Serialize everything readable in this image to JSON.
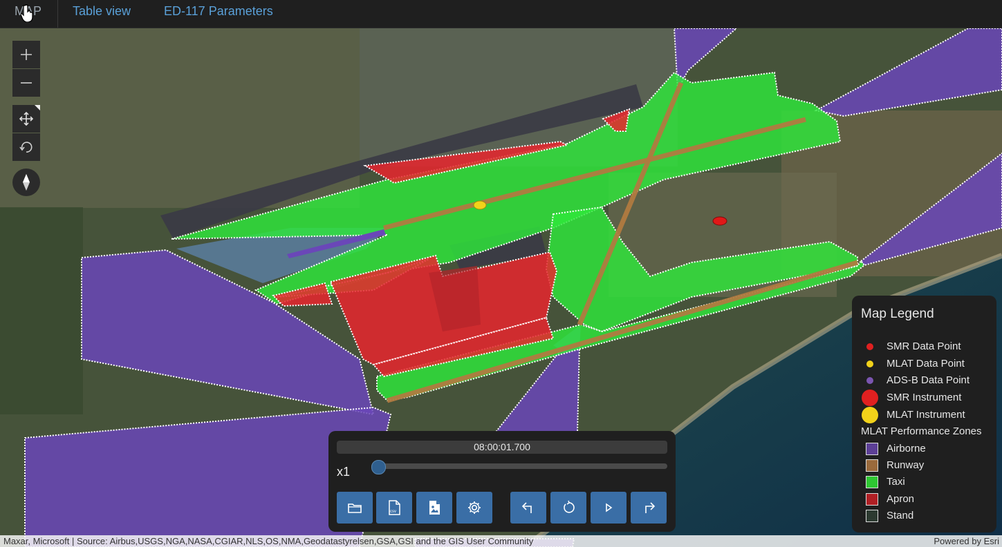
{
  "tabs": [
    {
      "label": "MAP"
    },
    {
      "label": "Table view"
    },
    {
      "label": "ED-117 Parameters"
    }
  ],
  "map_controls": {
    "zoom_in": "+",
    "zoom_out": "—",
    "icons": [
      "plus-icon",
      "minus-icon",
      "pan-icon",
      "rotate-icon",
      "compass-icon"
    ]
  },
  "attribution": {
    "left": "Maxar, Microsoft | Source: Airbus,USGS,NGA,NASA,CGIAR,NLS,OS,NMA,Geodatastyrelsen,GSA,GSI and the GIS User Community",
    "right": "Powered by Esri"
  },
  "legend": {
    "title": "Map Legend",
    "items": [
      {
        "label": "SMR Data Point",
        "color": "#e02020",
        "kind": "dot"
      },
      {
        "label": "MLAT Data Point",
        "color": "#f2d21a",
        "kind": "dot"
      },
      {
        "label": "ADS-B Data Point",
        "color": "#7b55b0",
        "kind": "dot"
      },
      {
        "label": "SMR Instrument",
        "color": "#e02020",
        "kind": "big-dot"
      },
      {
        "label": "MLAT Instrument",
        "color": "#f2d21a",
        "kind": "big-dot"
      }
    ],
    "zones_title": "MLAT Performance Zones",
    "zones": [
      {
        "label": "Airborne",
        "color": "#5c3f96"
      },
      {
        "label": "Runway",
        "color": "#9a6a3c"
      },
      {
        "label": "Taxi",
        "color": "#2ec732"
      },
      {
        "label": "Apron",
        "color": "#b01f24"
      },
      {
        "label": "Stand",
        "color": "#2c3a30"
      }
    ]
  },
  "player": {
    "time": "08:00:01.700",
    "speed": "x1",
    "progress": 0.0,
    "buttons": [
      "folder-icon",
      "csv-icon",
      "image-file-icon",
      "gear-icon",
      "undo-icon",
      "reset-icon",
      "play-icon",
      "redo-icon"
    ]
  },
  "colors": {
    "airborne": "#6a47b8",
    "taxi": "#2ee83a",
    "apron": "#e8262e",
    "stand": "#3a3a44",
    "runway": "#b07a40",
    "accent": "#3a6ea6"
  }
}
